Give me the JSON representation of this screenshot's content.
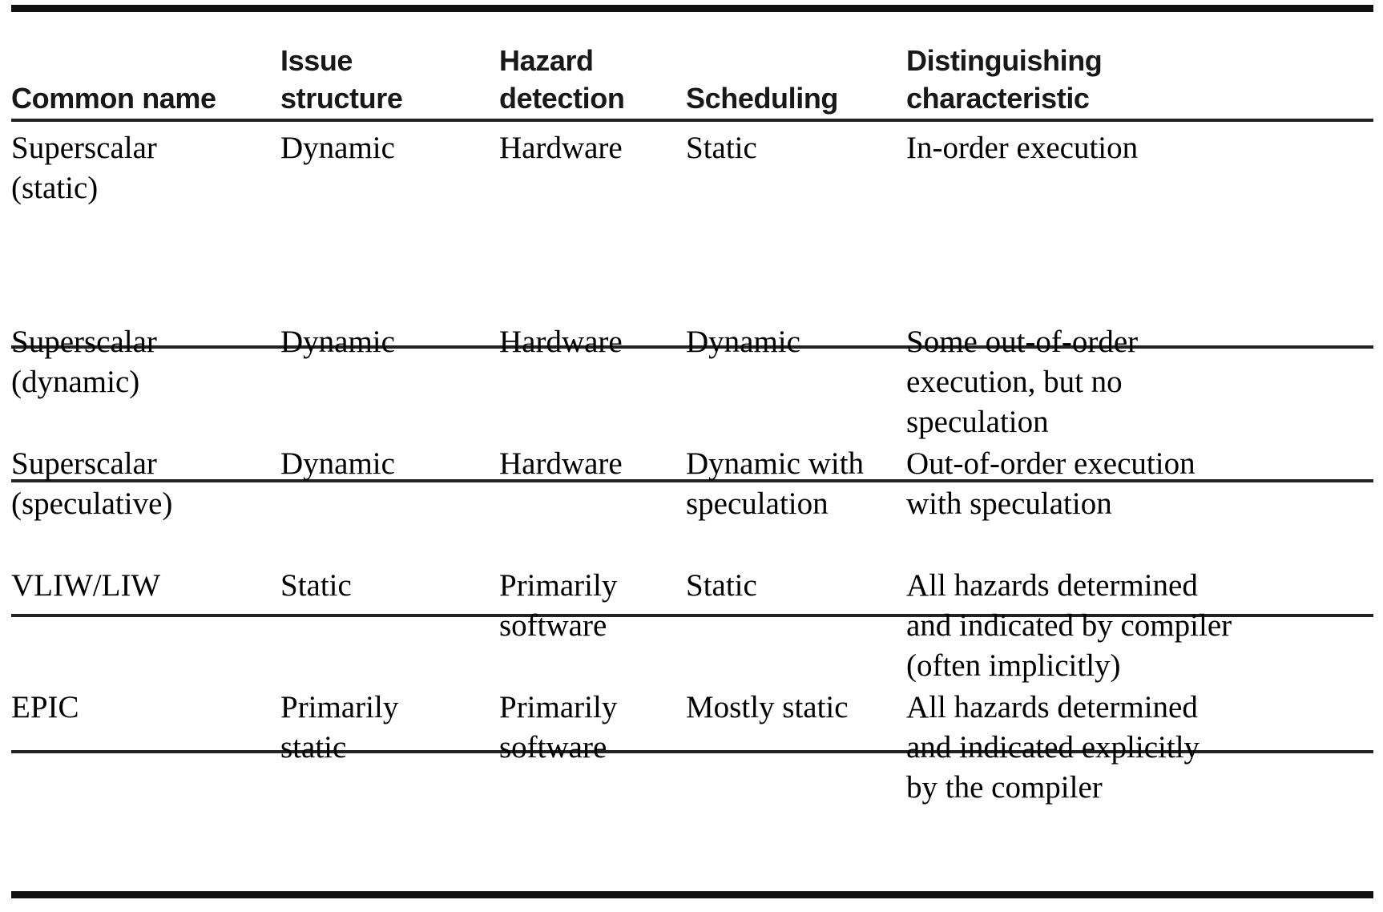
{
  "table": {
    "columns": [
      "Common name",
      "Issue\nstructure",
      "Hazard\ndetection",
      "Scheduling",
      "Distinguishing\ncharacteristic"
    ],
    "rows": [
      {
        "common_name": "Superscalar\n(static)",
        "issue_structure": "Dynamic",
        "hazard_detection": "Hardware",
        "scheduling": "Static",
        "distinguishing_characteristic": "In-order execution"
      },
      {
        "common_name": "Superscalar\n(dynamic)",
        "issue_structure": "Dynamic",
        "hazard_detection": "Hardware",
        "scheduling": "Dynamic",
        "distinguishing_characteristic": "Some out-of-order\nexecution, but no\nspeculation"
      },
      {
        "common_name": "Superscalar\n(speculative)",
        "issue_structure": "Dynamic",
        "hazard_detection": "Hardware",
        "scheduling": "Dynamic with\nspeculation",
        "distinguishing_characteristic": "Out-of-order execution\nwith speculation"
      },
      {
        "common_name": "VLIW/LIW",
        "issue_structure": "Static",
        "hazard_detection": "Primarily\nsoftware",
        "scheduling": "Static",
        "distinguishing_characteristic": "All hazards determined\nand indicated by compiler\n(often implicitly)"
      },
      {
        "common_name": "EPIC",
        "issue_structure": "Primarily\nstatic",
        "hazard_detection": "Primarily\nsoftware",
        "scheduling": "Mostly static",
        "distinguishing_characteristic": "All hazards determined\nand indicated explicitly\nby the compiler"
      }
    ]
  }
}
